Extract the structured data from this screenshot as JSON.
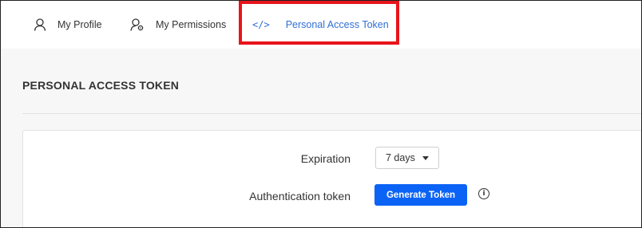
{
  "tabs": [
    {
      "label": "My Profile",
      "icon": "user-icon"
    },
    {
      "label": "My Permissions",
      "icon": "user-gear-icon"
    },
    {
      "label": "Personal Access Token",
      "icon": "code-icon",
      "icon_glyph": "</>",
      "active": true
    }
  ],
  "page": {
    "title": "PERSONAL ACCESS TOKEN"
  },
  "form": {
    "expiration_label": "Expiration",
    "expiration_value": "7 days",
    "auth_label": "Authentication token",
    "generate_button": "Generate Token",
    "info_icon_glyph": "i"
  },
  "colors": {
    "accent": "#0b63f6",
    "active_tab": "#2f6fd6",
    "highlight_box": "#e8141b"
  }
}
